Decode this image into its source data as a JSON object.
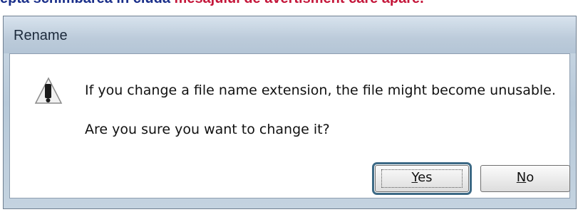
{
  "caption": {
    "part1": "epta schimbarea în ciuda ",
    "part2": "mesajului de avertisment care apare."
  },
  "dialog": {
    "title": "Rename",
    "icon": "warning-icon",
    "message_line1": "If you change a file name extension, the file might become unusable.",
    "message_line2": "Are you sure you want to change it?",
    "buttons": {
      "yes_mnemonic": "Y",
      "yes_rest": "es",
      "no_mnemonic": "N",
      "no_rest": "o"
    }
  },
  "colors": {
    "caption_blue": "#1a2f8a",
    "caption_red": "#c4163a",
    "focus_ring": "#3d6a86"
  }
}
